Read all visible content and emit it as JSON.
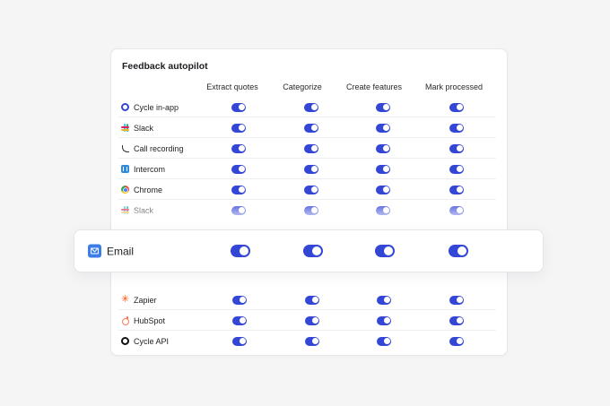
{
  "card": {
    "title": "Feedback autopilot",
    "columns": [
      "Extract quotes",
      "Categorize",
      "Create features",
      "Mark processed"
    ]
  },
  "rows_top": [
    {
      "label": "Cycle in-app",
      "icon": "cycle-icon"
    },
    {
      "label": "Slack",
      "icon": "slack-icon"
    },
    {
      "label": "Call recording",
      "icon": "phone-icon"
    },
    {
      "label": "Intercom",
      "icon": "intercom-icon"
    },
    {
      "label": "Chrome",
      "icon": "chrome-icon"
    },
    {
      "label": "Slack",
      "icon": "slack-icon"
    }
  ],
  "highlight": {
    "label": "Email",
    "icon": "email-icon"
  },
  "rows_bottom": [
    {
      "label": "Zapier",
      "icon": "zapier-icon"
    },
    {
      "label": "HubSpot",
      "icon": "hubspot-icon"
    },
    {
      "label": "Cycle API",
      "icon": "cycle-api-icon"
    }
  ],
  "toggle_state": "on",
  "colors": {
    "accent": "#3446d6",
    "background": "#f5f5f6",
    "email_icon": "#3b7ce8"
  }
}
